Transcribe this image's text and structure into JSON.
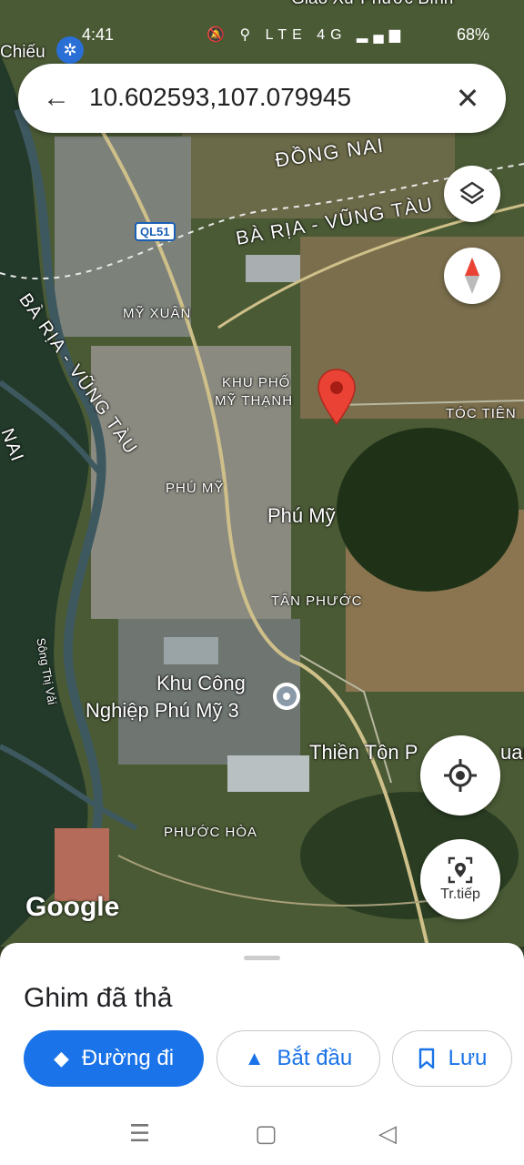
{
  "status_bar": {
    "time": "4:41",
    "battery": "68%",
    "icons": "🔕 ⚲ LTE 4G ▂▄▆"
  },
  "search": {
    "query": "10.602593,107.079945"
  },
  "map": {
    "labels": {
      "dong_nai": "ĐỒNG NAI",
      "ba_ria_vung_tau": "BÀ RỊA - VŨNG TÀU",
      "ba_ria_vung_tau_left": "BÀ RỊA - VŨNG TÀU",
      "nai_left": "NAI",
      "ql51": "QL51",
      "my_xuan": "MỸ XUÂN",
      "khu_pho": "KHU PHỐ",
      "my_thanh": "MỸ THẠNH",
      "toc_tien": "TÓC TIÊN",
      "phu_my_small": "PHÚ MỸ",
      "phu_my": "Phú Mỹ",
      "tan_phuoc": "TÂN PHƯỚC",
      "khu_cong_nghiep_1": "Khu Công",
      "khu_cong_nghiep_2": "Nghiệp Phú Mỹ 3",
      "thien_ton": "Thiền Tôn P",
      "thien_ton_end": "uan",
      "phuoc_hoa": "PHƯỚC HÒA",
      "song_thi_vai": "Sông Thị Vải",
      "chieu": "Chiếu",
      "giao_xu": "Giáo Xứ Phước Bình"
    },
    "watermark": "Google"
  },
  "buttons": {
    "traffic_label": "Tr.tiếp"
  },
  "sheet": {
    "title": "Ghim đã thả",
    "directions": "Đường đi",
    "start": "Bắt đầu",
    "save": "Lưu"
  },
  "colors": {
    "accent": "#1a73e8",
    "pin": "#ea4335"
  }
}
